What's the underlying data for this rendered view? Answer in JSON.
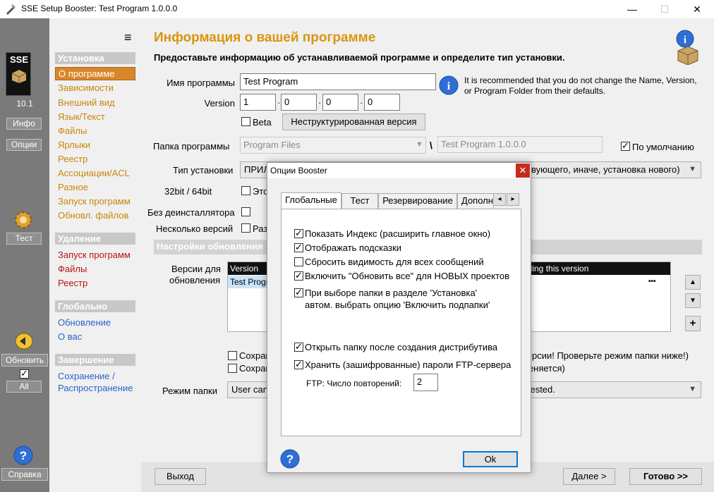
{
  "window": {
    "title": "SSE Setup Booster: Test Program 1.0.0.0",
    "minimize": "—",
    "maximize": "☐",
    "close": "✕"
  },
  "sidebar": {
    "logo": "SSE",
    "version": "10.1",
    "info_button": "Инфо",
    "options_button": "Опции",
    "test_button": "Тест",
    "update_button": "Обновить",
    "all_button": "All",
    "help_button": "Справка"
  },
  "nav": {
    "menu_icon": "≡",
    "install_header": "Установка",
    "install_items": [
      "О программе",
      "Зависимости",
      "Внешний вид",
      "Язык/Текст",
      "Файлы",
      "Ярлыки",
      "Реестр",
      "Ассоциации/ACL",
      "Разное",
      "Запуск программ",
      "Обновл. файлов"
    ],
    "uninstall_header": "Удаление",
    "uninstall_items": [
      "Запуск программ",
      "Файлы",
      "Реестр"
    ],
    "global_header": "Глобально",
    "global_items": [
      "Обновление",
      "О вас"
    ],
    "finish_header": "Завершение",
    "finish_items": [
      "Сохранение /",
      "Распространение"
    ]
  },
  "main": {
    "title": "Информация о вашей программе",
    "subtitle": "Предоставьте информацию об устанавливаемой программе и определите тип установки.",
    "name_label": "Имя программы",
    "name_value": "Test Program",
    "hint": "It is recommended that you do not change the Name, Version, or Program Folder from their defaults.",
    "version_label": "Version",
    "version_parts": [
      "1",
      "0",
      "0",
      "0"
    ],
    "beta_label": "Beta",
    "unstructured_button": "Неструктурированная версия",
    "folder_label": "Папка программы",
    "folder_base": "Program Files",
    "folder_sep": "\\",
    "folder_name": "Test Program 1.0.0.0",
    "default_label": "По умолчанию",
    "install_type_label": "Тип установки",
    "install_type_value_left": "ПРИЛ",
    "install_type_value_right": "твующего, иначе, установка нового)",
    "bitness_label": "32bit / 64bit",
    "bitness_option": "Это",
    "no_uninstaller_label": "Без деинсталлятора",
    "multi_version_label": "Несколько версий",
    "multi_version_option": "Разр",
    "update_settings_header": "Настройки обновления",
    "versions_label_1": "Версии для",
    "versions_label_2": "обновления",
    "table_col_version": "Version",
    "table_col_right": "rading this version",
    "table_row": "Test Progr",
    "table_more": "•••",
    "up_button": "▲",
    "down_button": "▼",
    "add_button": "+",
    "save_opt_1": "Сохран",
    "save_opt_2": "Сохран",
    "warn_1": "версии! Проверьте режим папки ниже!)",
    "warn_2": "меняется)",
    "folder_mode_label": "Режим папки",
    "folder_mode_left": "User can",
    "folder_mode_right": "ggested.",
    "exit_button": "Выход",
    "next_button": "Далее >",
    "done_button": "Готово >>"
  },
  "dialog": {
    "title": "Опции Booster",
    "close": "✕",
    "tabs": [
      "Глобальные",
      "Тест",
      "Резервирование",
      "Дополн"
    ],
    "tab_prev": "◂",
    "tab_next": "▸",
    "options": [
      {
        "label": "Показать Индекс (расширить главное окно)",
        "checked": true
      },
      {
        "label": "Отображать подсказки",
        "checked": true
      },
      {
        "label": "Сбросить видимость для всех сообщений",
        "checked": false
      },
      {
        "label": "Включить \"Обновить все\" для НОВЫХ проектов",
        "checked": true
      },
      {
        "label": "При выборе папки в разделе 'Установка'",
        "checked": true
      },
      {
        "label": "автом. выбрать опцию 'Включить подпапки'",
        "checked": false
      }
    ],
    "options2": [
      {
        "label": "Открыть папку после создания дистрибутива",
        "checked": true
      },
      {
        "label": "Хранить (зашифрованные) пароли FTP-сервера",
        "checked": true
      }
    ],
    "ftp_label": "FTP: Число повторений:",
    "ftp_value": "2",
    "ok_button": "Ok"
  },
  "colors": {
    "accent_orange": "#d9960c",
    "nav_selected": "#d9862a",
    "red_items": "#b81414",
    "blue_items": "#2a62c9"
  }
}
